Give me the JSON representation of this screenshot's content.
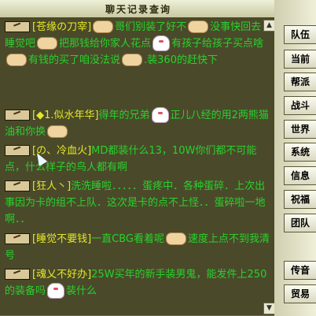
{
  "window": {
    "title": "聊天记录查询",
    "close_glyph": "×"
  },
  "messages": [
    {
      "name": "[苍缘の刀宰]",
      "parts": [
        "哥们别装了好不",
        "没事快回去睡觉吧",
        "把那钱给你家人花点",
        "有孩子给孩子买点啥",
        "有钱的买了咱没法说",
        ".装360的赶快下"
      ]
    },
    {
      "name": "[◆1.似水年华]",
      "parts": [
        "得年的兄弟",
        "正儿八经的用2两熊猫油和你换"
      ]
    },
    {
      "name": "[の、冷血",
      "name2": "火]",
      "parts": [
        "MD都装什么13，10W你们都不可能点，",
        "什么样子的鸟人都有啊"
      ]
    },
    {
      "name": "[狂人丶]",
      "parts": [
        "洗洗睡啦．．．．．蛋疼中．各种蛋碎．上次出事因为卡的组不上队．这次是卡的点不上怪．．蛋碎啦一地啊．．"
      ]
    },
    {
      "name": "[睡觉不要钱]",
      "parts": [
        "一直CBG看着呢",
        "速度上点不到我清号"
      ]
    },
    {
      "name": "[魂乂不好办]",
      "parts": [
        "25W买年的新手装男鬼，能发件上250的装备吗",
        "装什么"
      ]
    }
  ],
  "tabs": [
    "队伍",
    "当前",
    "帮派",
    "战斗",
    "世界",
    "系统",
    "信息",
    "祝福",
    "团队",
    "传音",
    "贸易"
  ],
  "scroll": {
    "up": "▲",
    "down": "▼"
  },
  "icons": {
    "channel": "speaker-channel-icon",
    "emote_hand": "handshake-emote-icon",
    "emote_sheep": "sheep-emote-icon"
  }
}
